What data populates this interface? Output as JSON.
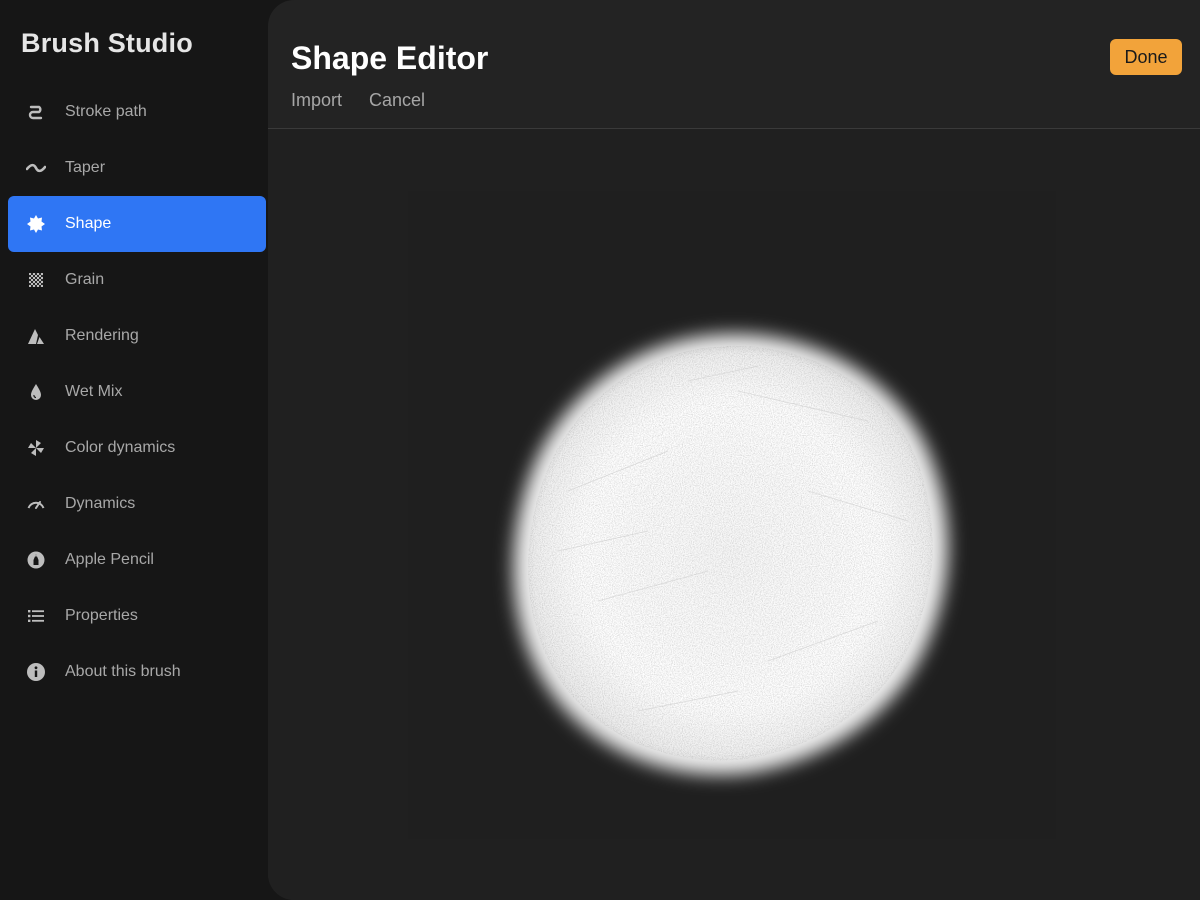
{
  "sidebar": {
    "title": "Brush Studio",
    "items": [
      {
        "label": "Stroke path",
        "icon": "stroke-path-icon",
        "active": false
      },
      {
        "label": "Taper",
        "icon": "taper-icon",
        "active": false
      },
      {
        "label": "Shape",
        "icon": "shape-icon",
        "active": true
      },
      {
        "label": "Grain",
        "icon": "grain-icon",
        "active": false
      },
      {
        "label": "Rendering",
        "icon": "rendering-icon",
        "active": false
      },
      {
        "label": "Wet Mix",
        "icon": "droplet-icon",
        "active": false
      },
      {
        "label": "Color dynamics",
        "icon": "pinwheel-icon",
        "active": false
      },
      {
        "label": "Dynamics",
        "icon": "speedometer-icon",
        "active": false
      },
      {
        "label": "Apple Pencil",
        "icon": "pencil-icon",
        "active": false
      },
      {
        "label": "Properties",
        "icon": "list-icon",
        "active": false
      },
      {
        "label": "About this brush",
        "icon": "info-icon",
        "active": false
      }
    ]
  },
  "main": {
    "title": "Shape Editor",
    "import_label": "Import",
    "cancel_label": "Cancel",
    "done_label": "Done"
  },
  "colors": {
    "accent_blue": "#2f76f4",
    "done_orange": "#f2a33a",
    "panel": "#232323",
    "sidebar_bg": "#161616"
  }
}
